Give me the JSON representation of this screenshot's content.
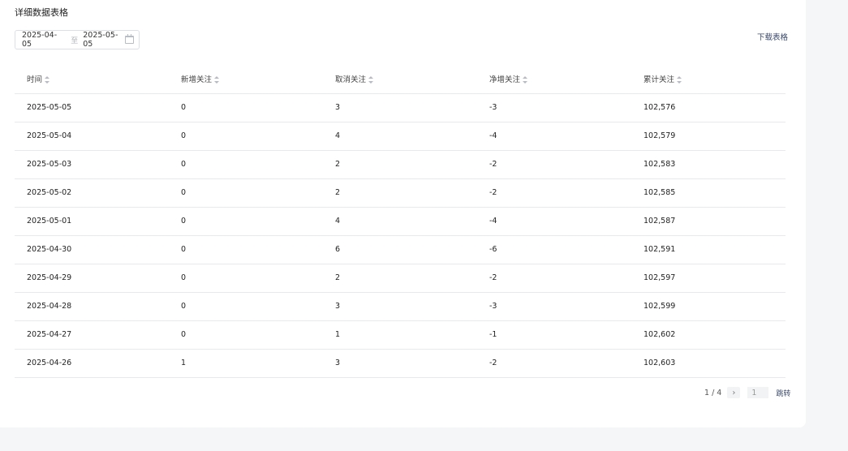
{
  "section": {
    "title": "详细数据表格"
  },
  "date_range": {
    "start": "2025-04-05",
    "separator": "至",
    "end": "2025-05-05",
    "icon": "calendar-icon"
  },
  "download": {
    "label": "下载表格"
  },
  "table": {
    "columns": [
      "时间",
      "新增关注",
      "取消关注",
      "净增关注",
      "累计关注"
    ],
    "rows": [
      [
        "2025-05-05",
        "0",
        "3",
        "-3",
        "102,576"
      ],
      [
        "2025-05-04",
        "0",
        "4",
        "-4",
        "102,579"
      ],
      [
        "2025-05-03",
        "0",
        "2",
        "-2",
        "102,583"
      ],
      [
        "2025-05-02",
        "0",
        "2",
        "-2",
        "102,585"
      ],
      [
        "2025-05-01",
        "0",
        "4",
        "-4",
        "102,587"
      ],
      [
        "2025-04-30",
        "0",
        "6",
        "-6",
        "102,591"
      ],
      [
        "2025-04-29",
        "0",
        "2",
        "-2",
        "102,597"
      ],
      [
        "2025-04-28",
        "0",
        "3",
        "-3",
        "102,599"
      ],
      [
        "2025-04-27",
        "0",
        "1",
        "-1",
        "102,602"
      ],
      [
        "2025-04-26",
        "1",
        "3",
        "-2",
        "102,603"
      ]
    ]
  },
  "pagination": {
    "page_info": "1 / 4",
    "next_icon": "›",
    "page_input_value": "1",
    "jump_label": "跳转"
  }
}
